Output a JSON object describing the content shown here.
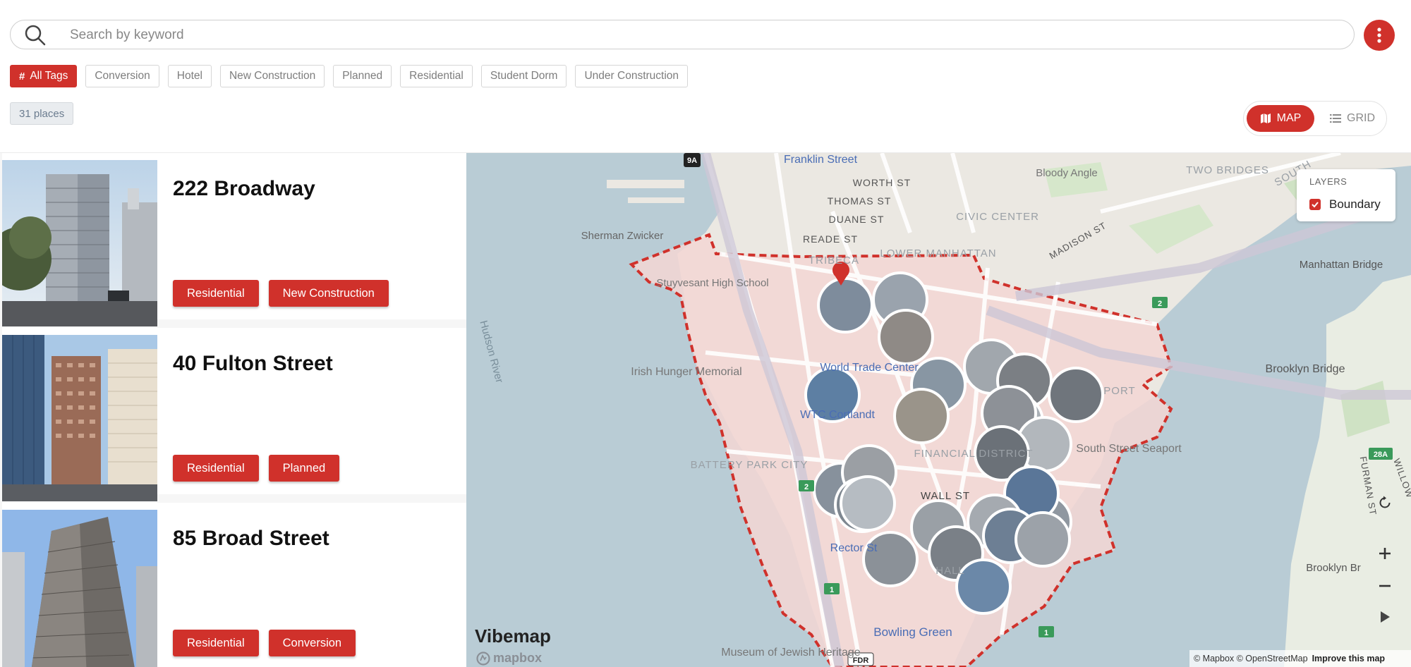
{
  "search": {
    "placeholder": "Search by keyword"
  },
  "tags": {
    "all_label": "All Tags",
    "items": [
      "Conversion",
      "Hotel",
      "New Construction",
      "Planned",
      "Residential",
      "Student Dorm",
      "Under Construction"
    ]
  },
  "count_label": "31 places",
  "view_toggle": {
    "map": "MAP",
    "grid": "GRID",
    "selected": "MAP"
  },
  "places": [
    {
      "name": "222 Broadway",
      "tags": [
        "Residential",
        "New Construction"
      ]
    },
    {
      "name": "40 Fulton Street",
      "tags": [
        "Residential",
        "Planned"
      ]
    },
    {
      "name": "85 Broad Street",
      "tags": [
        "Residential",
        "Conversion"
      ]
    }
  ],
  "map": {
    "labels": {
      "franklin": "Franklin Street",
      "worth": "WORTH ST",
      "thomas": "THOMAS ST",
      "duane": "DUANE ST",
      "reade": "READE ST",
      "tribeca": "TRIBECA",
      "lower_manhattan": "LOWER MANHATTAN",
      "civic_center": "CIVIC CENTER",
      "madison": "MADISON ST",
      "bloody_angle": "Bloody Angle",
      "two_bridges": "TWO BRIDGES",
      "south": "SOUTH",
      "manhattan_bridge": "Manhattan Bridge",
      "sherman": "Sherman Zwicker",
      "stuyvesant": "Stuyvesant High School",
      "hudson": "Hudson River",
      "irish": "Irish Hunger Memorial",
      "wtc": "World Trade Center",
      "wtc_cortlandt": "WTC Cortlandt",
      "brooklyn_bridge": "Brooklyn Bridge",
      "port": "PORT",
      "seaport": "South Street Seaport",
      "battery": "BATTERY PARK CITY",
      "financial": "FINANCIAL DISTRICT",
      "wall_st": "WALL ST",
      "rector": "Rector St",
      "hall": "HALL",
      "bowling_green": "Bowling Green",
      "museum": "Museum of Jewish Heritage",
      "furman": "FURMAN ST",
      "willow": "WILLOW",
      "brooklyn_br": "Brooklyn Br",
      "shield_9a": "9A",
      "shield_2a": "2",
      "shield_2b": "2",
      "shield_1a": "1",
      "shield_1b": "1",
      "shield_28a": "28A",
      "shield_fdr": "FDR"
    },
    "layers": {
      "title": "LAYERS",
      "boundary_label": "Boundary",
      "boundary_checked": true
    },
    "attribution": {
      "text": "© Mapbox © OpenStreetMap",
      "improve": "Improve this map"
    },
    "brand": "Vibemap",
    "mapbox": "mapbox"
  },
  "colors": {
    "accent": "#d0312b",
    "water": "#b9ccd5",
    "boundary_fill": "#f3d6d3",
    "boundary_stroke": "#d0312b"
  }
}
